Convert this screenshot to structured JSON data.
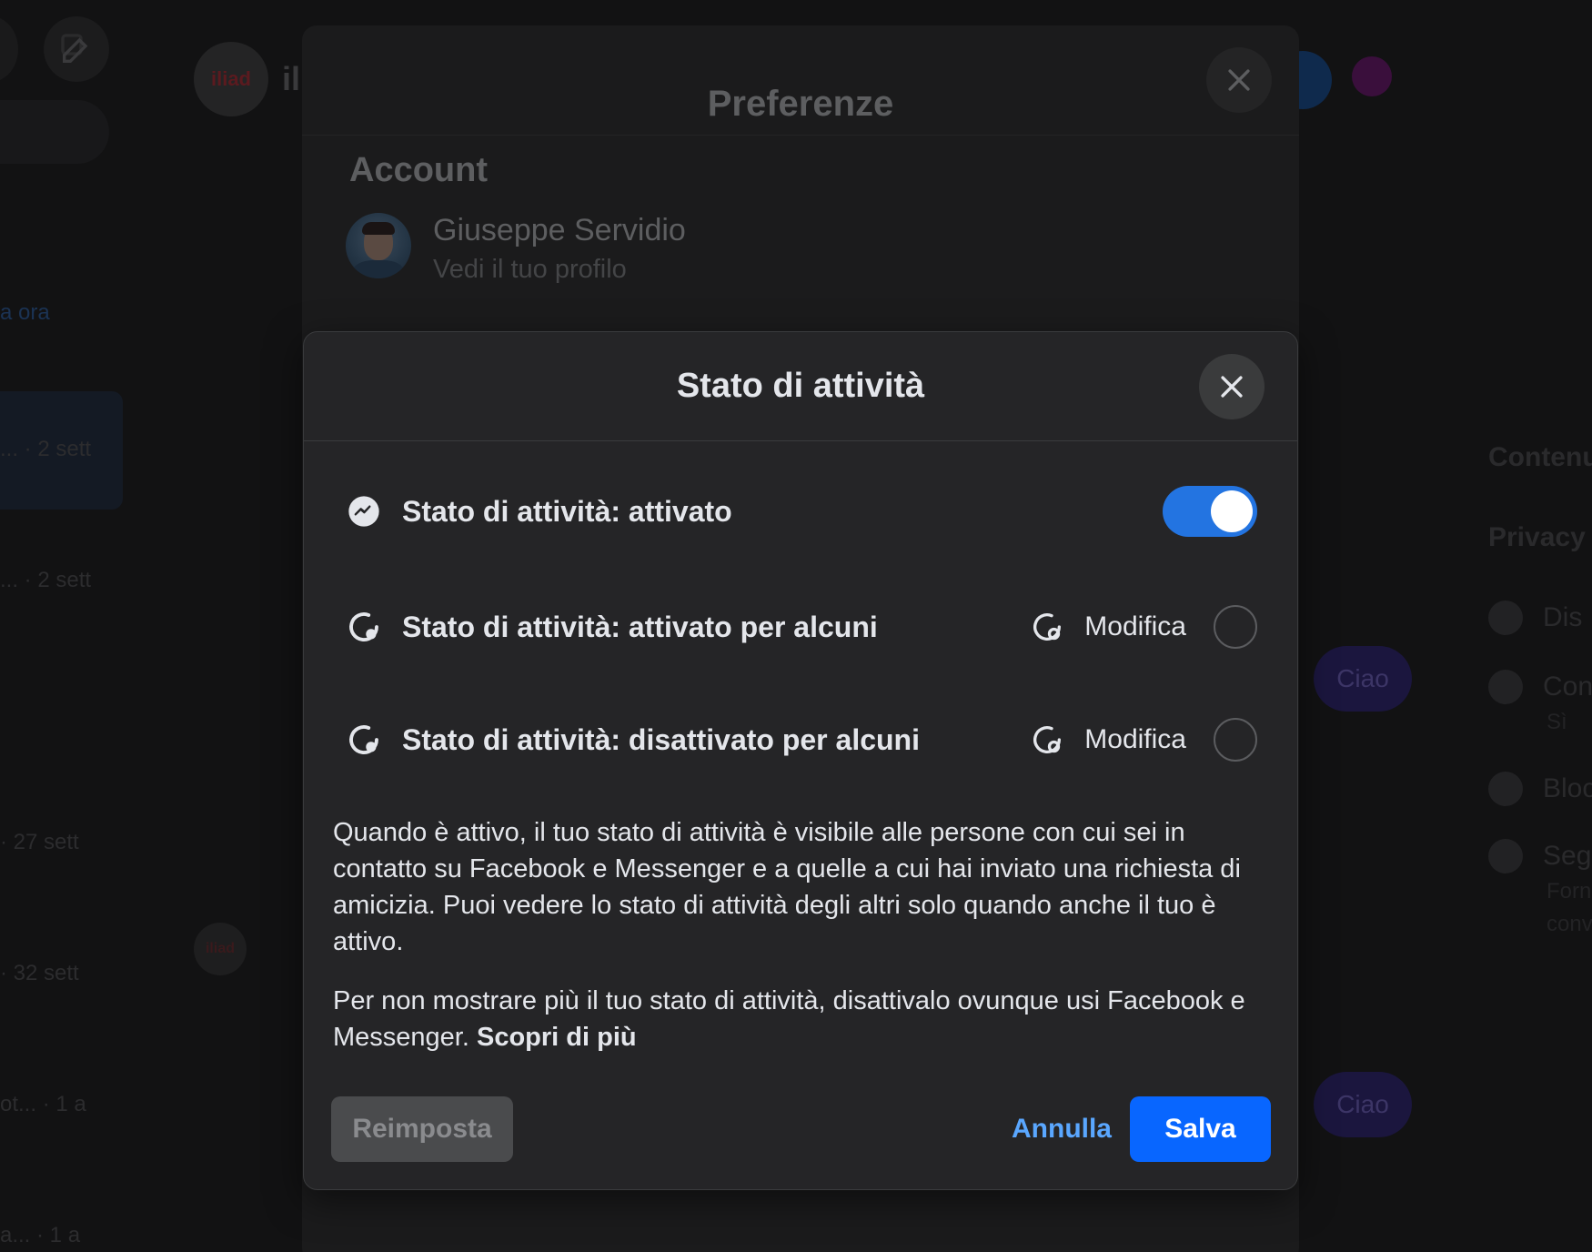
{
  "background": {
    "brand_text": "iliad",
    "header_name_fragment": "ili",
    "sidebar_times": [
      {
        "text": "a ora",
        "highlight": true
      },
      {
        "text": "... · 2 sett",
        "highlight": false
      },
      {
        "text": "... · 2 sett",
        "highlight": false
      },
      {
        "text": "· 27 sett",
        "highlight": false
      },
      {
        "text": "· 32 sett",
        "highlight": false
      },
      {
        "text": "ot... · 1 a",
        "highlight": false
      },
      {
        "text": "a... · 1 a",
        "highlight": false
      }
    ],
    "chat_bubbles": [
      "Ciao",
      "Ciao"
    ],
    "right_panel": {
      "section_1": "Contenu",
      "section_2": "Privacy",
      "items": [
        {
          "label": "Dis",
          "icon": "bell-icon"
        },
        {
          "label": "Con",
          "sub": "Sì",
          "icon": "eye-icon"
        },
        {
          "label": "Bloc",
          "icon": "block-icon"
        },
        {
          "label": "Seg",
          "sub": "Forn",
          "sub2": "conv",
          "icon": "report-icon"
        }
      ]
    }
  },
  "preferences": {
    "title": "Preferenze",
    "section": "Account",
    "account_name": "Giuseppe Servidio",
    "account_link": "Vedi il tuo profilo"
  },
  "dialog": {
    "title": "Stato di attività",
    "options": [
      {
        "label": "Stato di attività: attivato",
        "icon": "messenger-icon",
        "control": "toggle",
        "on": true
      },
      {
        "label": "Stato di attività: attivato per alcuni",
        "icon": "active-status-icon",
        "edit_label": "Modifica",
        "control": "radio",
        "selected": false
      },
      {
        "label": "Stato di attività: disattivato per alcuni",
        "icon": "active-status-icon",
        "edit_label": "Modifica",
        "control": "radio",
        "selected": false
      }
    ],
    "description_1": "Quando è attivo, il tuo stato di attività è visibile alle persone con cui sei in contatto su Facebook e Messenger e a quelle a cui hai inviato una richiesta di amicizia. Puoi vedere lo stato di attività degli altri solo quando anche il tuo è attivo.",
    "description_2": "Per non mostrare più il tuo stato di attività, disattivalo ovunque usi Facebook e Messenger.",
    "learn_more": "Scopri di più",
    "buttons": {
      "reset": "Reimposta",
      "cancel": "Annulla",
      "save": "Salva"
    }
  },
  "colors": {
    "accent": "#0866ff",
    "toggle_on": "#2374e1",
    "link": "#5aa7ff",
    "dialog_bg": "#252527"
  }
}
